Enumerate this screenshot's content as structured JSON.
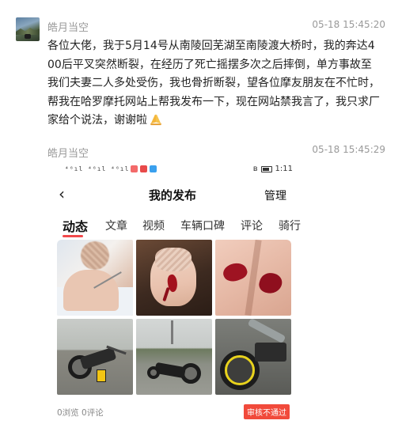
{
  "post1": {
    "username": "皓月当空",
    "timestamp": "05-18 15:45:20",
    "message": "各位大佬，我于5月14号从南陵回芜湖至南陵渡大桥时，我的奔达400后平叉突然断裂，在经历了死亡摇摆多次之后摔倒，单方事故至我们夫妻二人多处受伤，我也骨折断裂，望各位摩友朋友在不忙时，帮我在哈罗摩托网站上帮我发布一下，现在网站禁我言了，我只求厂家给个说法，谢谢啦",
    "emoji": "pray-hands"
  },
  "post2": {
    "username": "皓月当空",
    "timestamp": "05-18 15:45:29"
  },
  "screenshot": {
    "status_left": "⁴⁶ıl ⁴⁶ıl ⁴⁶ıl",
    "status_time": "1:11",
    "nav_title": "我的发布",
    "manage": "管理",
    "back": "‹",
    "tabs": [
      "动态",
      "文章",
      "视频",
      "车辆口碑",
      "评论",
      "骑行"
    ],
    "stats": "0浏览  0评论",
    "review_status": "审核不通过",
    "photos": [
      "hospital-patient",
      "injured-face",
      "knee-wounds",
      "crashed-motorcycle-road",
      "motorcycle-on-highway",
      "bent-swingarm"
    ]
  },
  "colors": {
    "accent": "#f2494b",
    "reject_bg": "#f14a3b",
    "meta_text": "#999999"
  }
}
